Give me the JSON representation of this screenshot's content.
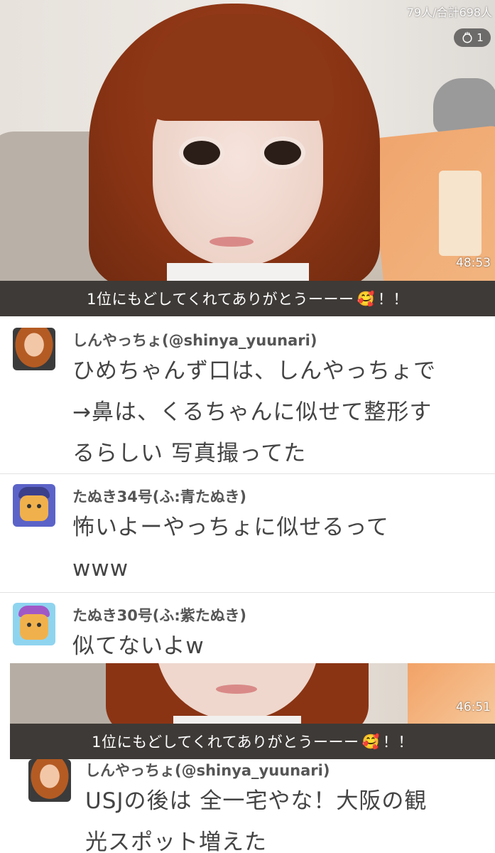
{
  "video_top": {
    "viewer_count": "79人/合計698人",
    "like_count": "1",
    "time": "48:53"
  },
  "banner_top": {
    "text": "1位にもどしてくれてありがとうーーー",
    "emoji": "🥰",
    "suffix": "！！"
  },
  "comments": [
    {
      "username": "しんやっちょ(@shinya_yuunari)",
      "lines": [
        "ひめちゃんず口は、しんやっちょで",
        "→鼻は、くるちゃんに似せて整形す",
        "るらしい 写真撮ってた"
      ]
    },
    {
      "username": "たぬき34号(ふ:青たぬき)",
      "lines": [
        "怖いよーやっちょに似せるって",
        "www"
      ]
    },
    {
      "username": "たぬき30号(ふ:紫たぬき)",
      "lines": [
        "似てないよw"
      ]
    }
  ],
  "video_bottom": {
    "time": "46:51"
  },
  "banner_bottom": {
    "text": "1位にもどしてくれてありがとうーーー",
    "emoji": "🥰",
    "suffix": "！！"
  },
  "comment_bottom": {
    "username": "しんやっちょ(@shinya_yuunari)",
    "lines": [
      "USJの後は 全一宅やな！大阪の観",
      "光スポット増えた"
    ]
  },
  "colors": {
    "banner_bg": "#3e3a37",
    "hair": "#8a3414",
    "pillow": "#f0a56d"
  }
}
